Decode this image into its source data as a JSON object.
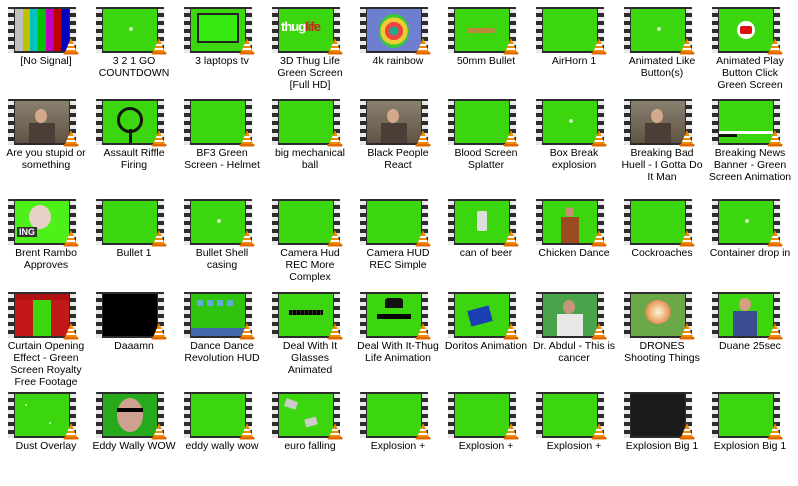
{
  "items": [
    {
      "label": "[No Signal]",
      "thumb": "colorbars"
    },
    {
      "label": "3 2 1 GO COUNTDOWN",
      "thumb": "green-dot"
    },
    {
      "label": "3 laptops tv",
      "thumb": "monitor"
    },
    {
      "label": "3D Thug Life Green Screen [Full HD]",
      "thumb": "thug-text"
    },
    {
      "label": "4k rainbow",
      "thumb": "rainbow"
    },
    {
      "label": "50mm Bullet",
      "thumb": "bullet"
    },
    {
      "label": "AirHorn 1",
      "thumb": "green"
    },
    {
      "label": "Animated Like Button(s)",
      "thumb": "green-dot"
    },
    {
      "label": "Animated Play Button Click Green Screen",
      "thumb": "play-button"
    },
    {
      "label": "Are you stupid or something",
      "thumb": "photo"
    },
    {
      "label": "Assault Riffle Firing",
      "thumb": "scope"
    },
    {
      "label": "BF3 Green Screen - Helmet",
      "thumb": "green"
    },
    {
      "label": "big mechanical ball",
      "thumb": "green"
    },
    {
      "label": "Black People React",
      "thumb": "photo"
    },
    {
      "label": "Blood Screen Splatter",
      "thumb": "green"
    },
    {
      "label": "Box Break explosion",
      "thumb": "green-dot"
    },
    {
      "label": "Breaking Bad Huell - I Gotta Do It Man",
      "thumb": "photo"
    },
    {
      "label": "Breaking News Banner - Green Screen Animation",
      "thumb": "banner"
    },
    {
      "label": "Brent Rambo Approves",
      "thumb": "rambo"
    },
    {
      "label": "Bullet 1",
      "thumb": "green"
    },
    {
      "label": "Bullet Shell casing",
      "thumb": "green-dot"
    },
    {
      "label": "Camera Hud REC More Complex",
      "thumb": "green"
    },
    {
      "label": "Camera HUD REC Simple",
      "thumb": "green"
    },
    {
      "label": "can of beer",
      "thumb": "can"
    },
    {
      "label": "Chicken Dance",
      "thumb": "person"
    },
    {
      "label": "Cockroaches",
      "thumb": "green"
    },
    {
      "label": "Container drop in",
      "thumb": "green-dot"
    },
    {
      "label": "Curtain Opening Effect - Green Screen Royalty Free Footage",
      "thumb": "curtain"
    },
    {
      "label": "Daaamn",
      "thumb": "black"
    },
    {
      "label": "Dance Dance Revolution HUD",
      "thumb": "ddr"
    },
    {
      "label": "Deal With It Glasses Animated",
      "thumb": "glasses"
    },
    {
      "label": "Deal With It-Thug Life Animation",
      "thumb": "glasses-hat"
    },
    {
      "label": "Doritos Animation",
      "thumb": "doritos"
    },
    {
      "label": "Dr. Abdul - This is cancer",
      "thumb": "doctor"
    },
    {
      "label": "DRONES Shooting Things",
      "thumb": "explosion"
    },
    {
      "label": "Duane 25sec",
      "thumb": "person-blue"
    },
    {
      "label": "Dust Overlay",
      "thumb": "dust"
    },
    {
      "label": "Eddy Wally WOW",
      "thumb": "eddy"
    },
    {
      "label": "eddy wally wow",
      "thumb": "green"
    },
    {
      "label": "euro falling",
      "thumb": "euro"
    },
    {
      "label": "Explosion +",
      "thumb": "green"
    },
    {
      "label": "Explosion +",
      "thumb": "green"
    },
    {
      "label": "Explosion +",
      "thumb": "green"
    },
    {
      "label": "Explosion Big 1",
      "thumb": "dark-green"
    },
    {
      "label": "Explosion Big 1",
      "thumb": "green"
    }
  ],
  "icon": "vlc-cone-icon"
}
